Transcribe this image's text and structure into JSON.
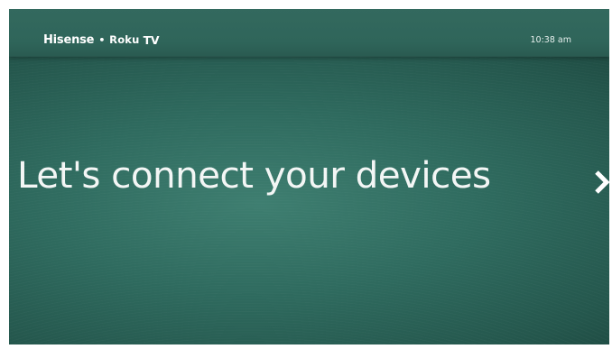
{
  "header": {
    "brand": "Hisense",
    "separator": "•",
    "brand_roku": "Roku",
    "brand_tv": "TV",
    "time": "10:38 am"
  },
  "main": {
    "headline": "Let's connect your devices"
  },
  "icons": {
    "next": "chevron-right-icon"
  },
  "colors": {
    "background": "#2f6b5f",
    "text": "#f3f6f5"
  }
}
